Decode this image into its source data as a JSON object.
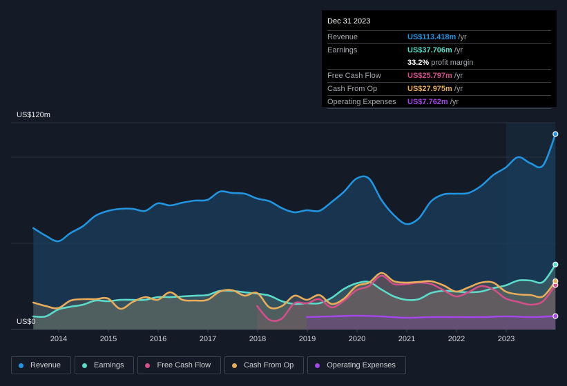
{
  "tooltip": {
    "date": "Dec 31 2023",
    "rows": [
      {
        "label": "Revenue",
        "value": "US$113.418m",
        "unit": "/yr",
        "color": "#2394df"
      },
      {
        "label": "Earnings",
        "value": "US$37.706m",
        "unit": "/yr",
        "color": "#5cdbca"
      },
      {
        "label": "",
        "value": "33.2%",
        "unit": "profit margin",
        "color": "#ffffff"
      },
      {
        "label": "Free Cash Flow",
        "value": "US$25.797m",
        "unit": "/yr",
        "color": "#d1508a"
      },
      {
        "label": "Cash From Op",
        "value": "US$27.975m",
        "unit": "/yr",
        "color": "#e8ad5c"
      },
      {
        "label": "Operating Expenses",
        "value": "US$7.762m",
        "unit": "/yr",
        "color": "#a347e6"
      }
    ]
  },
  "legend": [
    {
      "label": "Revenue",
      "color": "#2394df"
    },
    {
      "label": "Earnings",
      "color": "#5cdbca"
    },
    {
      "label": "Free Cash Flow",
      "color": "#d1508a"
    },
    {
      "label": "Cash From Op",
      "color": "#e8ad5c"
    },
    {
      "label": "Operating Expenses",
      "color": "#a347e6"
    }
  ],
  "chart_data": {
    "type": "area",
    "title": "",
    "xlabel": "",
    "ylabel": "",
    "y_top_label": "US$120m",
    "y_bottom_label": "US$0",
    "ylim": [
      0,
      120
    ],
    "xlim": [
      2013.49,
      2023.99
    ],
    "gridlines": [
      0,
      50,
      100,
      120
    ],
    "highlight_start": 2023.0,
    "x_ticks": [
      "2014",
      "2015",
      "2016",
      "2017",
      "2018",
      "2019",
      "2020",
      "2021",
      "2022",
      "2023"
    ],
    "x_tick_values": [
      2014,
      2015,
      2016,
      2017,
      2018,
      2019,
      2020,
      2021,
      2022,
      2023
    ],
    "series": [
      {
        "name": "Revenue",
        "color": "#2394df",
        "x": [
          2013.49,
          2013.74,
          2013.99,
          2014.24,
          2014.49,
          2014.74,
          2014.99,
          2015.24,
          2015.49,
          2015.74,
          2015.99,
          2016.24,
          2016.49,
          2016.74,
          2016.99,
          2017.24,
          2017.49,
          2017.74,
          2017.99,
          2018.24,
          2018.49,
          2018.74,
          2018.99,
          2019.24,
          2019.49,
          2019.74,
          2019.99,
          2020.24,
          2020.49,
          2020.74,
          2020.99,
          2021.24,
          2021.49,
          2021.74,
          2021.99,
          2022.24,
          2022.49,
          2022.74,
          2022.99,
          2023.24,
          2023.49,
          2023.74,
          2023.99
        ],
        "values": [
          58.8,
          54.4,
          51.2,
          56,
          60,
          66,
          68.8,
          70,
          70,
          68.8,
          73.2,
          72,
          73.6,
          74.8,
          75.2,
          80,
          79.2,
          78.8,
          76,
          74.4,
          70.4,
          68,
          69.2,
          68.8,
          74,
          80,
          87.6,
          87.6,
          75.2,
          66.4,
          61.2,
          64.4,
          74.4,
          78.4,
          78.8,
          79.2,
          83.2,
          89.6,
          94,
          100,
          96.4,
          95.2,
          113.4
        ]
      },
      {
        "name": "Earnings",
        "color": "#5cdbca",
        "x": [
          2013.49,
          2013.74,
          2013.99,
          2014.24,
          2014.49,
          2014.74,
          2014.99,
          2015.24,
          2015.49,
          2015.74,
          2015.99,
          2016.24,
          2016.49,
          2016.74,
          2016.99,
          2017.24,
          2017.49,
          2017.74,
          2017.99,
          2018.24,
          2018.49,
          2018.74,
          2018.99,
          2019.24,
          2019.49,
          2019.74,
          2019.99,
          2020.24,
          2020.49,
          2020.74,
          2020.99,
          2021.24,
          2021.49,
          2021.74,
          2021.99,
          2022.24,
          2022.49,
          2022.74,
          2022.99,
          2023.24,
          2023.49,
          2023.74,
          2023.99
        ],
        "values": [
          7.6,
          7.6,
          11.6,
          13.2,
          14.4,
          16.8,
          16.4,
          17.2,
          17.2,
          17.2,
          18.8,
          18.8,
          19.2,
          19.6,
          20,
          22.4,
          22.4,
          21.6,
          20.8,
          19.6,
          16.4,
          14.8,
          15.2,
          15.2,
          18.4,
          23.6,
          26.8,
          27.6,
          23.2,
          19.2,
          17.2,
          17.6,
          21.2,
          22.4,
          22,
          21.6,
          22,
          24,
          25.6,
          28.4,
          28.4,
          27.6,
          37.7
        ]
      },
      {
        "name": "Free Cash Flow",
        "color": "#d1508a",
        "x": [
          2017.99,
          2018.24,
          2018.49,
          2018.74,
          2018.99,
          2019.24,
          2019.49,
          2019.74,
          2019.99,
          2020.24,
          2020.49,
          2020.74,
          2020.99,
          2021.24,
          2021.49,
          2021.74,
          2021.99,
          2022.24,
          2022.49,
          2022.74,
          2022.99,
          2023.24,
          2023.49,
          2023.74,
          2023.99
        ],
        "values": [
          13.6,
          5.6,
          6.4,
          15.2,
          15.2,
          17.6,
          12.8,
          16.8,
          22.8,
          25.2,
          31.2,
          26.4,
          26.4,
          27.2,
          26.4,
          22.8,
          19.2,
          21.6,
          25.2,
          23.2,
          18,
          16,
          14.4,
          16.4,
          25.8
        ]
      },
      {
        "name": "Cash From Op",
        "color": "#e8ad5c",
        "x": [
          2013.49,
          2013.74,
          2013.99,
          2014.24,
          2014.49,
          2014.74,
          2014.99,
          2015.24,
          2015.49,
          2015.74,
          2015.99,
          2016.24,
          2016.49,
          2016.74,
          2016.99,
          2017.24,
          2017.49,
          2017.74,
          2017.99,
          2018.24,
          2018.49,
          2018.74,
          2018.99,
          2019.24,
          2019.49,
          2019.74,
          2019.99,
          2020.24,
          2020.49,
          2020.74,
          2020.99,
          2021.24,
          2021.49,
          2021.74,
          2021.99,
          2022.24,
          2022.49,
          2022.74,
          2022.99,
          2023.24,
          2023.49,
          2023.74,
          2023.99
        ],
        "values": [
          15.6,
          13.6,
          12.4,
          16.8,
          17.6,
          17.6,
          18,
          12,
          16,
          18.8,
          17.2,
          21.6,
          17.2,
          16.8,
          17.2,
          22,
          22.8,
          19.6,
          21.2,
          12.8,
          13.6,
          19.6,
          17.2,
          20,
          14.8,
          18,
          25.2,
          27.2,
          32.8,
          28,
          27.2,
          27.6,
          28,
          25.6,
          22,
          24.4,
          27.2,
          27.2,
          22,
          20.4,
          20,
          19.2,
          28
        ]
      },
      {
        "name": "Operating Expenses",
        "color": "#a347e6",
        "x": [
          2018.99,
          2019.49,
          2019.99,
          2020.49,
          2020.99,
          2021.49,
          2021.99,
          2022.49,
          2022.99,
          2023.49,
          2023.99
        ],
        "values": [
          7.2,
          7.6,
          8,
          7.6,
          6.8,
          7.2,
          7.2,
          7.2,
          7.6,
          7.2,
          7.76
        ]
      }
    ]
  }
}
